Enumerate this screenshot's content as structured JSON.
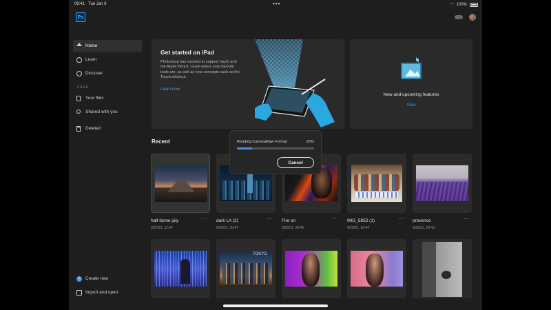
{
  "statusbar": {
    "time": "09:41",
    "date": "Tue Jan 9",
    "battery": "100%"
  },
  "app": {
    "logo": "Ps"
  },
  "sidebar": {
    "items": [
      {
        "label": "Home",
        "icon": "home-icon"
      },
      {
        "label": "Learn",
        "icon": "lightbulb-icon"
      },
      {
        "label": "Discover",
        "icon": "globe-icon"
      }
    ],
    "files_section": "FILES",
    "file_items": [
      {
        "label": "Your files",
        "icon": "file-icon"
      },
      {
        "label": "Shared with you",
        "icon": "shared-icon"
      },
      {
        "label": "Deleted",
        "icon": "trash-icon"
      }
    ],
    "bottom": [
      {
        "label": "Create new",
        "icon": "plus-icon"
      },
      {
        "label": "Import and open",
        "icon": "import-icon"
      }
    ]
  },
  "hero": {
    "title": "Get started on iPad",
    "body": "Photoshop has evolved to support touch and the Apple Pencil. Learn where your favorite tools are, as well as new concepts such as the Touch shortcut.",
    "link": "Learn now"
  },
  "features": {
    "title": "New and upcoming features",
    "link": "View"
  },
  "recent": {
    "title": "Recent",
    "files": [
      {
        "name": "half dome july",
        "date": "9/27/21, 11:44"
      },
      {
        "name": "dark LA (2)",
        "date": "9/26/21, 20:47"
      },
      {
        "name": "Fire on",
        "date": "9/26/21, 20:46"
      },
      {
        "name": "IMG_5852 (1)",
        "date": "9/26/21, 20:44"
      },
      {
        "name": "provence",
        "date": "9/26/21, 20:43"
      }
    ]
  },
  "modal": {
    "label": "Reading CameraRaw Format",
    "percent_text": "20%",
    "progress": 0.2,
    "cancel_label": "Cancel"
  },
  "colors": {
    "accent": "#4a8fe0",
    "link": "#4a9ff0",
    "background": "#1e1e1e",
    "card": "#2b2b2b"
  }
}
